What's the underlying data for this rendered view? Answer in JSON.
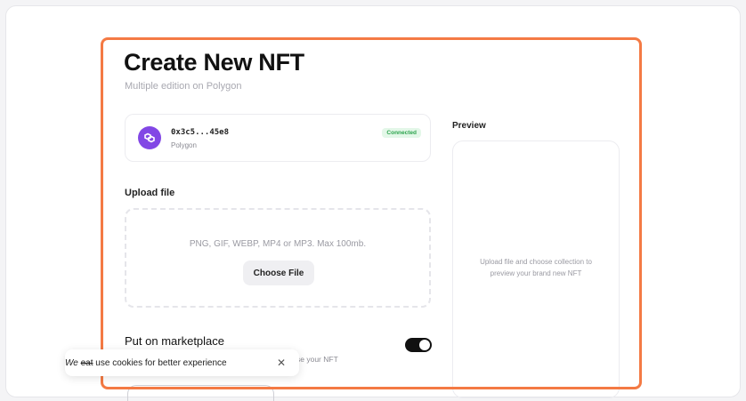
{
  "page": {
    "title": "Create New NFT",
    "subtitle": "Multiple edition on Polygon"
  },
  "wallet": {
    "address": "0x3c5...45e8",
    "network": "Polygon",
    "status": "Connected",
    "logo_icon": "polygon-logo-icon",
    "accent_color": "#8247e5"
  },
  "upload": {
    "label": "Upload file",
    "hint": "PNG, GIF, WEBP, MP4 or MP3. Max 100mb.",
    "button_label": "Choose File"
  },
  "marketplace": {
    "title": "Put on marketplace",
    "description_visible": "se your NFT",
    "enabled": true
  },
  "preview": {
    "label": "Preview",
    "placeholder": "Upload file and choose collection to preview your brand new NFT"
  },
  "cookie_banner": {
    "text_struck": "eat",
    "text_prefix": "We ",
    "text_suffix": " use cookies for better experience",
    "close_icon": "close-icon"
  },
  "colors": {
    "highlight_border": "#f47a44",
    "connected_badge": "#2da44e"
  }
}
